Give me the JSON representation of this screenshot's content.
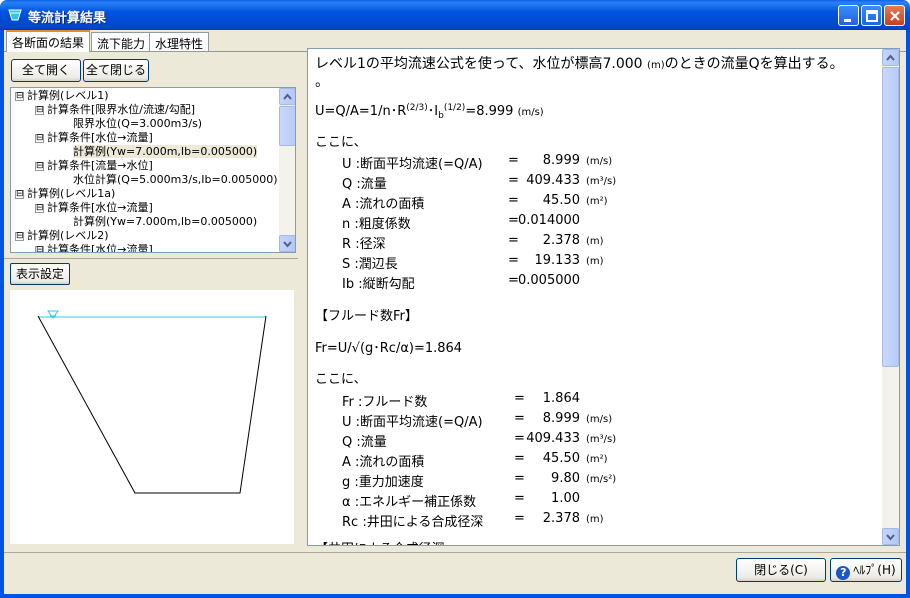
{
  "window": {
    "title": "等流計算結果"
  },
  "tabs": [
    {
      "label": "各断面の結果"
    },
    {
      "label": "流下能力"
    },
    {
      "label": "水理特性"
    }
  ],
  "tree_buttons": {
    "expand_all": "全て開く",
    "collapse_all": "全て閉じる"
  },
  "tree": {
    "items": [
      {
        "label": "計算例(レベル1)",
        "expander": "⊟"
      },
      {
        "label": "計算条件[限界水位/流速/勾配]",
        "expander": "⊟"
      },
      {
        "label": "限界水位(Q=3.000m3/s)",
        "expander": ""
      },
      {
        "label": "計算条件[水位→流量]",
        "expander": "⊟"
      },
      {
        "label": "計算例(Yw=7.000m,Ib=0.005000)",
        "expander": "",
        "selected": true
      },
      {
        "label": "計算条件[流量→水位]",
        "expander": "⊟"
      },
      {
        "label": "水位計算(Q=5.000m3/s,Ib=0.005000)",
        "expander": ""
      },
      {
        "label": "計算例(レベル1a)",
        "expander": "⊟"
      },
      {
        "label": "計算条件[水位→流量]",
        "expander": "⊟"
      },
      {
        "label": "計算例(Yw=7.000m,Ib=0.005000)",
        "expander": ""
      },
      {
        "label": "計算例(レベル2)",
        "expander": "⊟"
      },
      {
        "label": "計算条件[水位→流量]",
        "expander": "⊟"
      }
    ]
  },
  "display_settings_label": "表示設定",
  "report": {
    "intro_line1": "レベル1の平均流速公式を使って、水位が標高7.000",
    "intro_unit": "(m)",
    "intro_line1_end": "のときの流量Qを算出する。",
    "intro_line2": "。",
    "formula_main": "U=Q/A=1/n･R",
    "formula_exp1": "(2/3)",
    "formula_mid": "･I",
    "formula_sub": "b",
    "formula_exp2": "(1/2)",
    "formula_result": "=8.999",
    "formula_unit": "(m/s)",
    "where1": "ここに、",
    "vars1": [
      {
        "sym": "U",
        "desc": ":断面平均流速(=Q/A)",
        "eq": "=",
        "val": "8.999",
        "unit": "(m/s)"
      },
      {
        "sym": "Q",
        "desc": ":流量",
        "eq": "=",
        "val": "409.433",
        "unit": "(m³/s)"
      },
      {
        "sym": "A",
        "desc": ":流れの面積",
        "eq": "=",
        "val": "45.50",
        "unit": "(m²)"
      },
      {
        "sym": "n",
        "desc": ":粗度係数",
        "eq": "=",
        "val": "0.014000",
        "unit": ""
      },
      {
        "sym": "R",
        "desc": ":径深",
        "eq": "=",
        "val": "2.378",
        "unit": "(m)"
      },
      {
        "sym": "S",
        "desc": ":潤辺長",
        "eq": "=",
        "val": "19.133",
        "unit": "(m)"
      },
      {
        "sym": "Ib",
        "desc": ":縦断勾配",
        "eq": "=",
        "val": "0.005000",
        "unit": ""
      }
    ],
    "froude_heading": "【フルード数Fr】",
    "froude_formula": "Fr=U/√(g･Rc/α)=1.864",
    "where2": "ここに、",
    "vars2": [
      {
        "sym": "Fr",
        "desc": ":フルード数",
        "eq": "=",
        "val": "1.864",
        "unit": ""
      },
      {
        "sym": "U",
        "desc": ":断面平均流速(=Q/A)",
        "eq": "=",
        "val": "8.999",
        "unit": "(m/s)"
      },
      {
        "sym": "Q",
        "desc": ":流量",
        "eq": "=",
        "val": "409.433",
        "unit": "(m³/s)"
      },
      {
        "sym": "A",
        "desc": ":流れの面積",
        "eq": "=",
        "val": "45.50",
        "unit": "(m²)"
      },
      {
        "sym": "g",
        "desc": ":重力加速度",
        "eq": "=",
        "val": "9.80",
        "unit": "(m/s²)"
      },
      {
        "sym": "α",
        "desc": ":エネルギー補正係数",
        "eq": "=",
        "val": "1.00",
        "unit": ""
      },
      {
        "sym": "Rc",
        "desc": ":井田による合成径深",
        "eq": "=",
        "val": "2.378",
        "unit": "(m)"
      }
    ],
    "cutoff_heading": "【井田による合成径深"
  },
  "footer": {
    "close_label": "閉じる(C)",
    "help_label": "ﾍﾙﾌﾟ(H)"
  },
  "colors": {
    "water_line": "#33ccdd",
    "title_bar": "#0053e1",
    "tab_accent": "#e68b2c"
  }
}
